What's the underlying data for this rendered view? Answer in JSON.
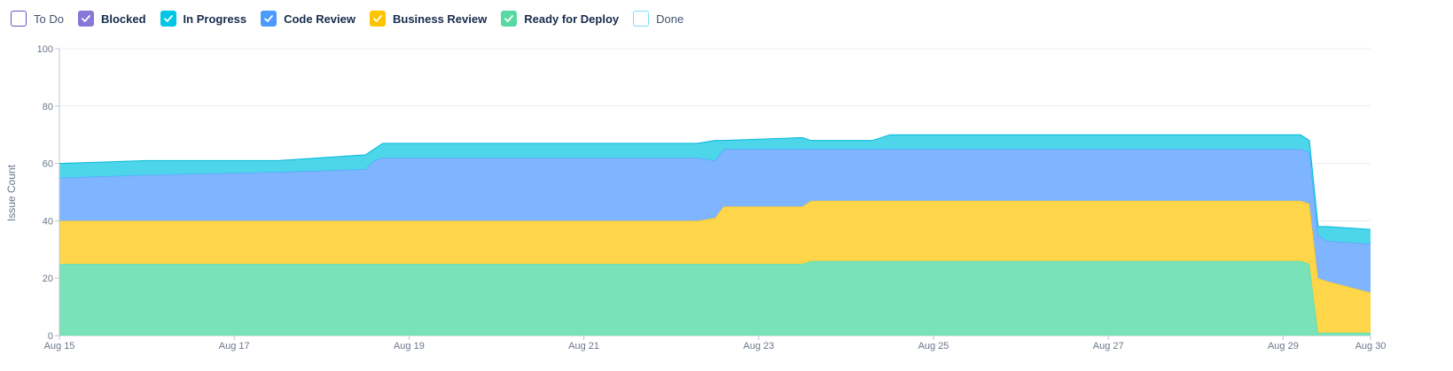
{
  "legend": [
    {
      "label": "To Do",
      "color": "#6554c0",
      "checked": false,
      "bold": false
    },
    {
      "label": "Blocked",
      "color": "#8777d9",
      "checked": true,
      "bold": true
    },
    {
      "label": "In Progress",
      "color": "#00c7e6",
      "checked": true,
      "bold": true
    },
    {
      "label": "Code Review",
      "color": "#4c9aff",
      "checked": true,
      "bold": true
    },
    {
      "label": "Business Review",
      "color": "#ffc400",
      "checked": true,
      "bold": true
    },
    {
      "label": "Ready for Deploy",
      "color": "#57d9a3",
      "checked": true,
      "bold": true
    },
    {
      "label": "Done",
      "color": "#79e2f2",
      "checked": false,
      "bold": false
    }
  ],
  "chart_data": {
    "type": "area",
    "stacked": true,
    "ylabel": "Issue Count",
    "xlabel": "",
    "ylim": [
      0,
      100
    ],
    "yticks": [
      0,
      20,
      40,
      60,
      80,
      100
    ],
    "xlim": [
      "Aug 15",
      "Aug 30"
    ],
    "xticks": [
      "Aug 15",
      "Aug 17",
      "Aug 19",
      "Aug 21",
      "Aug 23",
      "Aug 25",
      "Aug 27",
      "Aug 29",
      "Aug 30"
    ],
    "x_days": [
      15,
      16,
      17.5,
      18.5,
      18.6,
      18.7,
      22.3,
      22.5,
      22.6,
      23.5,
      23.6,
      24.3,
      24.5,
      29.2,
      29.3,
      29.4,
      29.5,
      30
    ],
    "series": [
      {
        "name": "Ready for Deploy",
        "color": "#79e2b9",
        "values": [
          25,
          25,
          25,
          25,
          25,
          25,
          25,
          25,
          25,
          25,
          26,
          26,
          26,
          26,
          25,
          1,
          1,
          1
        ]
      },
      {
        "name": "Business Review",
        "color": "#ffd54a",
        "values": [
          15,
          15,
          15,
          15,
          15,
          15,
          15,
          16,
          20,
          20,
          21,
          21,
          21,
          21,
          21,
          19,
          18,
          14
        ]
      },
      {
        "name": "Code Review",
        "color": "#7fb5ff",
        "values": [
          15,
          16,
          17,
          18,
          21,
          22,
          22,
          20,
          20,
          20,
          18,
          18,
          18,
          18,
          18,
          15,
          14,
          17
        ]
      },
      {
        "name": "In Progress",
        "color": "#4dd6ea",
        "values": [
          5,
          5,
          4,
          5,
          4,
          5,
          5,
          7,
          3,
          4,
          3,
          3,
          5,
          5,
          4,
          3,
          5,
          5
        ]
      }
    ]
  }
}
